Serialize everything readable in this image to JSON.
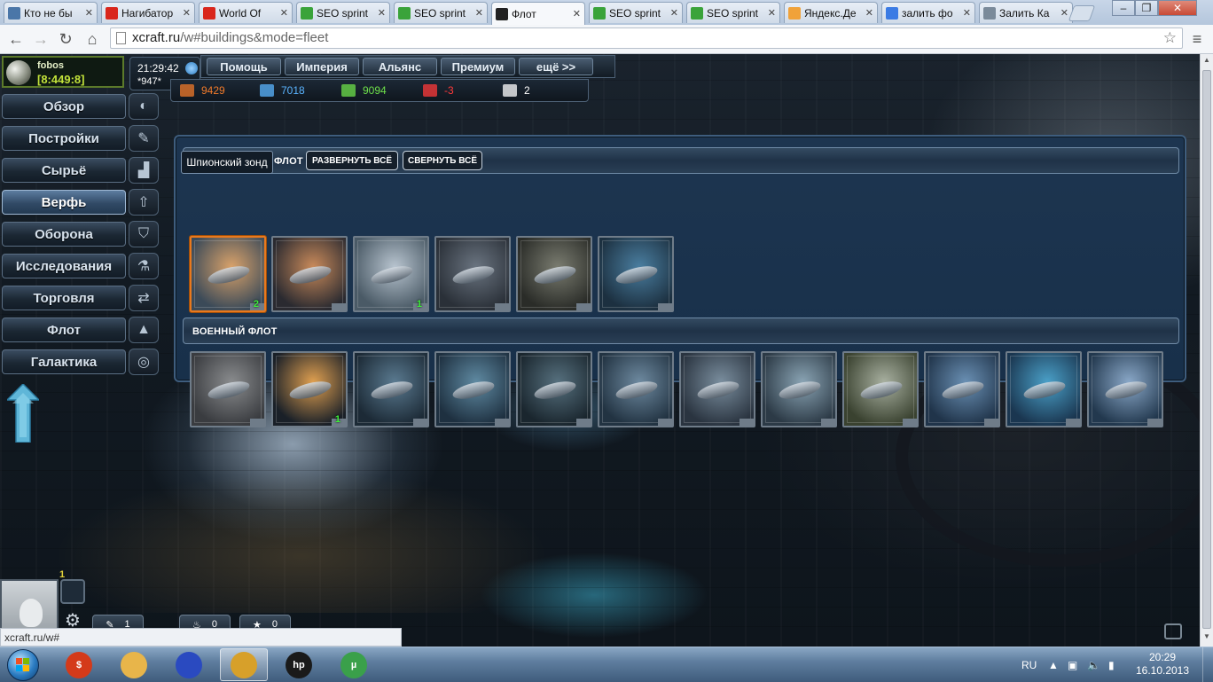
{
  "browser": {
    "tabs": [
      {
        "title": "Кто не бы",
        "favicon": "vk-icon",
        "color": "#4a76a8"
      },
      {
        "title": "Нагибатор",
        "favicon": "youtube-icon",
        "color": "#d9261c"
      },
      {
        "title": "World Of",
        "favicon": "youtube-icon",
        "color": "#d9261c"
      },
      {
        "title": "SEO sprint",
        "favicon": "seosprint-icon",
        "color": "#3aa33a"
      },
      {
        "title": "SEO sprint",
        "favicon": "seosprint-icon",
        "color": "#3aa33a"
      },
      {
        "title": "Флот",
        "favicon": "xcraft-icon",
        "color": "#222222",
        "active": true
      },
      {
        "title": "SEO sprint",
        "favicon": "seosprint-icon",
        "color": "#3aa33a"
      },
      {
        "title": "SEO sprint",
        "favicon": "seosprint-icon",
        "color": "#3aa33a"
      },
      {
        "title": "Яндекс.Де",
        "favicon": "yandex-icon",
        "color": "#f0a23a"
      },
      {
        "title": "залить фо",
        "favicon": "google-icon",
        "color": "#3b7be4"
      },
      {
        "title": "Залить Ка",
        "favicon": "page-icon",
        "color": "#7a8a9a"
      }
    ],
    "url_host": "xcraft.ru",
    "url_rest": "/w#buildings&mode=fleet",
    "status_text": "xcraft.ru/w#"
  },
  "player": {
    "name": "fobos",
    "coords": "[8:449:8]"
  },
  "header": {
    "time": "21:29:42",
    "server": "*947*",
    "nav": [
      "Помощь",
      "Империя",
      "Альянс",
      "Премиум",
      "ещё >>"
    ]
  },
  "resources": [
    {
      "icon": "metal-icon",
      "value": "9429",
      "color": "#f07a2a"
    },
    {
      "icon": "crystal-icon",
      "value": "7018",
      "color": "#5ab4ff"
    },
    {
      "icon": "deuterium-icon",
      "value": "9094",
      "color": "#6ee04a"
    },
    {
      "icon": "energy-icon",
      "value": "-3",
      "color": "#ff3a3a"
    },
    {
      "icon": "dark-matter-icon",
      "value": "2",
      "color": "#ffffff"
    }
  ],
  "menu": [
    {
      "label": "Обзор",
      "icon": "planet-icon"
    },
    {
      "label": "Постройки",
      "icon": "wrench-icon"
    },
    {
      "label": "Сырьё",
      "icon": "factory-icon"
    },
    {
      "label": "Верфь",
      "icon": "rocket-icon",
      "active": true
    },
    {
      "label": "Оборона",
      "icon": "shield-icon"
    },
    {
      "label": "Исследования",
      "icon": "research-icon"
    },
    {
      "label": "Торговля",
      "icon": "trade-arrows-icon"
    },
    {
      "label": "Флот",
      "icon": "fleet-rocket-icon"
    },
    {
      "label": "Галактика",
      "icon": "galaxy-icon"
    }
  ],
  "panel": {
    "civil_title": "ФЛОТ",
    "expand_all": "РАЗВЕРНУТЬ ВСЁ",
    "collapse_all": "СВЕРНУТЬ ВСЁ",
    "tooltip": "Шпионский зонд",
    "military_title": "ВОЕННЫЙ ФЛОТ",
    "civil_ships": [
      {
        "count": "2",
        "selected": true,
        "c1": "#d9a26a",
        "c2": "#3b4a58"
      },
      {
        "count": "",
        "c1": "#c98a5a",
        "c2": "#2a2a30"
      },
      {
        "count": "1",
        "c1": "#b8c4cf",
        "c2": "#4a5a66"
      },
      {
        "count": "",
        "c1": "#6a7480",
        "c2": "#2a3038"
      },
      {
        "count": "",
        "c1": "#7a7c70",
        "c2": "#2a2c28"
      },
      {
        "count": "",
        "c1": "#4a7ea0",
        "c2": "#1c3040"
      }
    ],
    "military_ships": [
      {
        "count": "",
        "c1": "#8a8c8e",
        "c2": "#3a3c40"
      },
      {
        "count": "1",
        "c1": "#e0a050",
        "c2": "#1a2028"
      },
      {
        "count": "",
        "c1": "#5a7a90",
        "c2": "#1c2a36"
      },
      {
        "count": "",
        "c1": "#5f8aa2",
        "c2": "#1e3040"
      },
      {
        "count": "",
        "c1": "#56707e",
        "c2": "#1a262e"
      },
      {
        "count": "",
        "c1": "#6e8aa0",
        "c2": "#223342"
      },
      {
        "count": "",
        "c1": "#7a8e9e",
        "c2": "#2a3440"
      },
      {
        "count": "",
        "c1": "#8aa4b4",
        "c2": "#2c3a46"
      },
      {
        "count": "",
        "c1": "#a8b0a0",
        "c2": "#3a4230"
      },
      {
        "count": "",
        "c1": "#6a90b4",
        "c2": "#20344a"
      },
      {
        "count": "",
        "c1": "#4aa0c8",
        "c2": "#1a3650"
      },
      {
        "count": "",
        "c1": "#8aa8c8",
        "c2": "#22384e"
      }
    ]
  },
  "bottom_widget": {
    "level": "1",
    "stats": [
      "1",
      "0",
      "0"
    ]
  },
  "taskbar": {
    "apps": [
      {
        "name": "money-app-icon",
        "color": "#d43a1a",
        "label": "$"
      },
      {
        "name": "explorer-icon",
        "color": "#e8b54a",
        "label": ""
      },
      {
        "name": "save-disk-icon",
        "color": "#2a4ac0",
        "label": ""
      },
      {
        "name": "chrome-icon",
        "color": "#d7a02a",
        "label": "",
        "active": true
      },
      {
        "name": "hp-icon",
        "color": "#1a1a1a",
        "label": "hp"
      },
      {
        "name": "utorrent-icon",
        "color": "#3aa04a",
        "label": "µ"
      }
    ],
    "lang": "RU",
    "time": "20:29",
    "date": "16.10.2013"
  }
}
